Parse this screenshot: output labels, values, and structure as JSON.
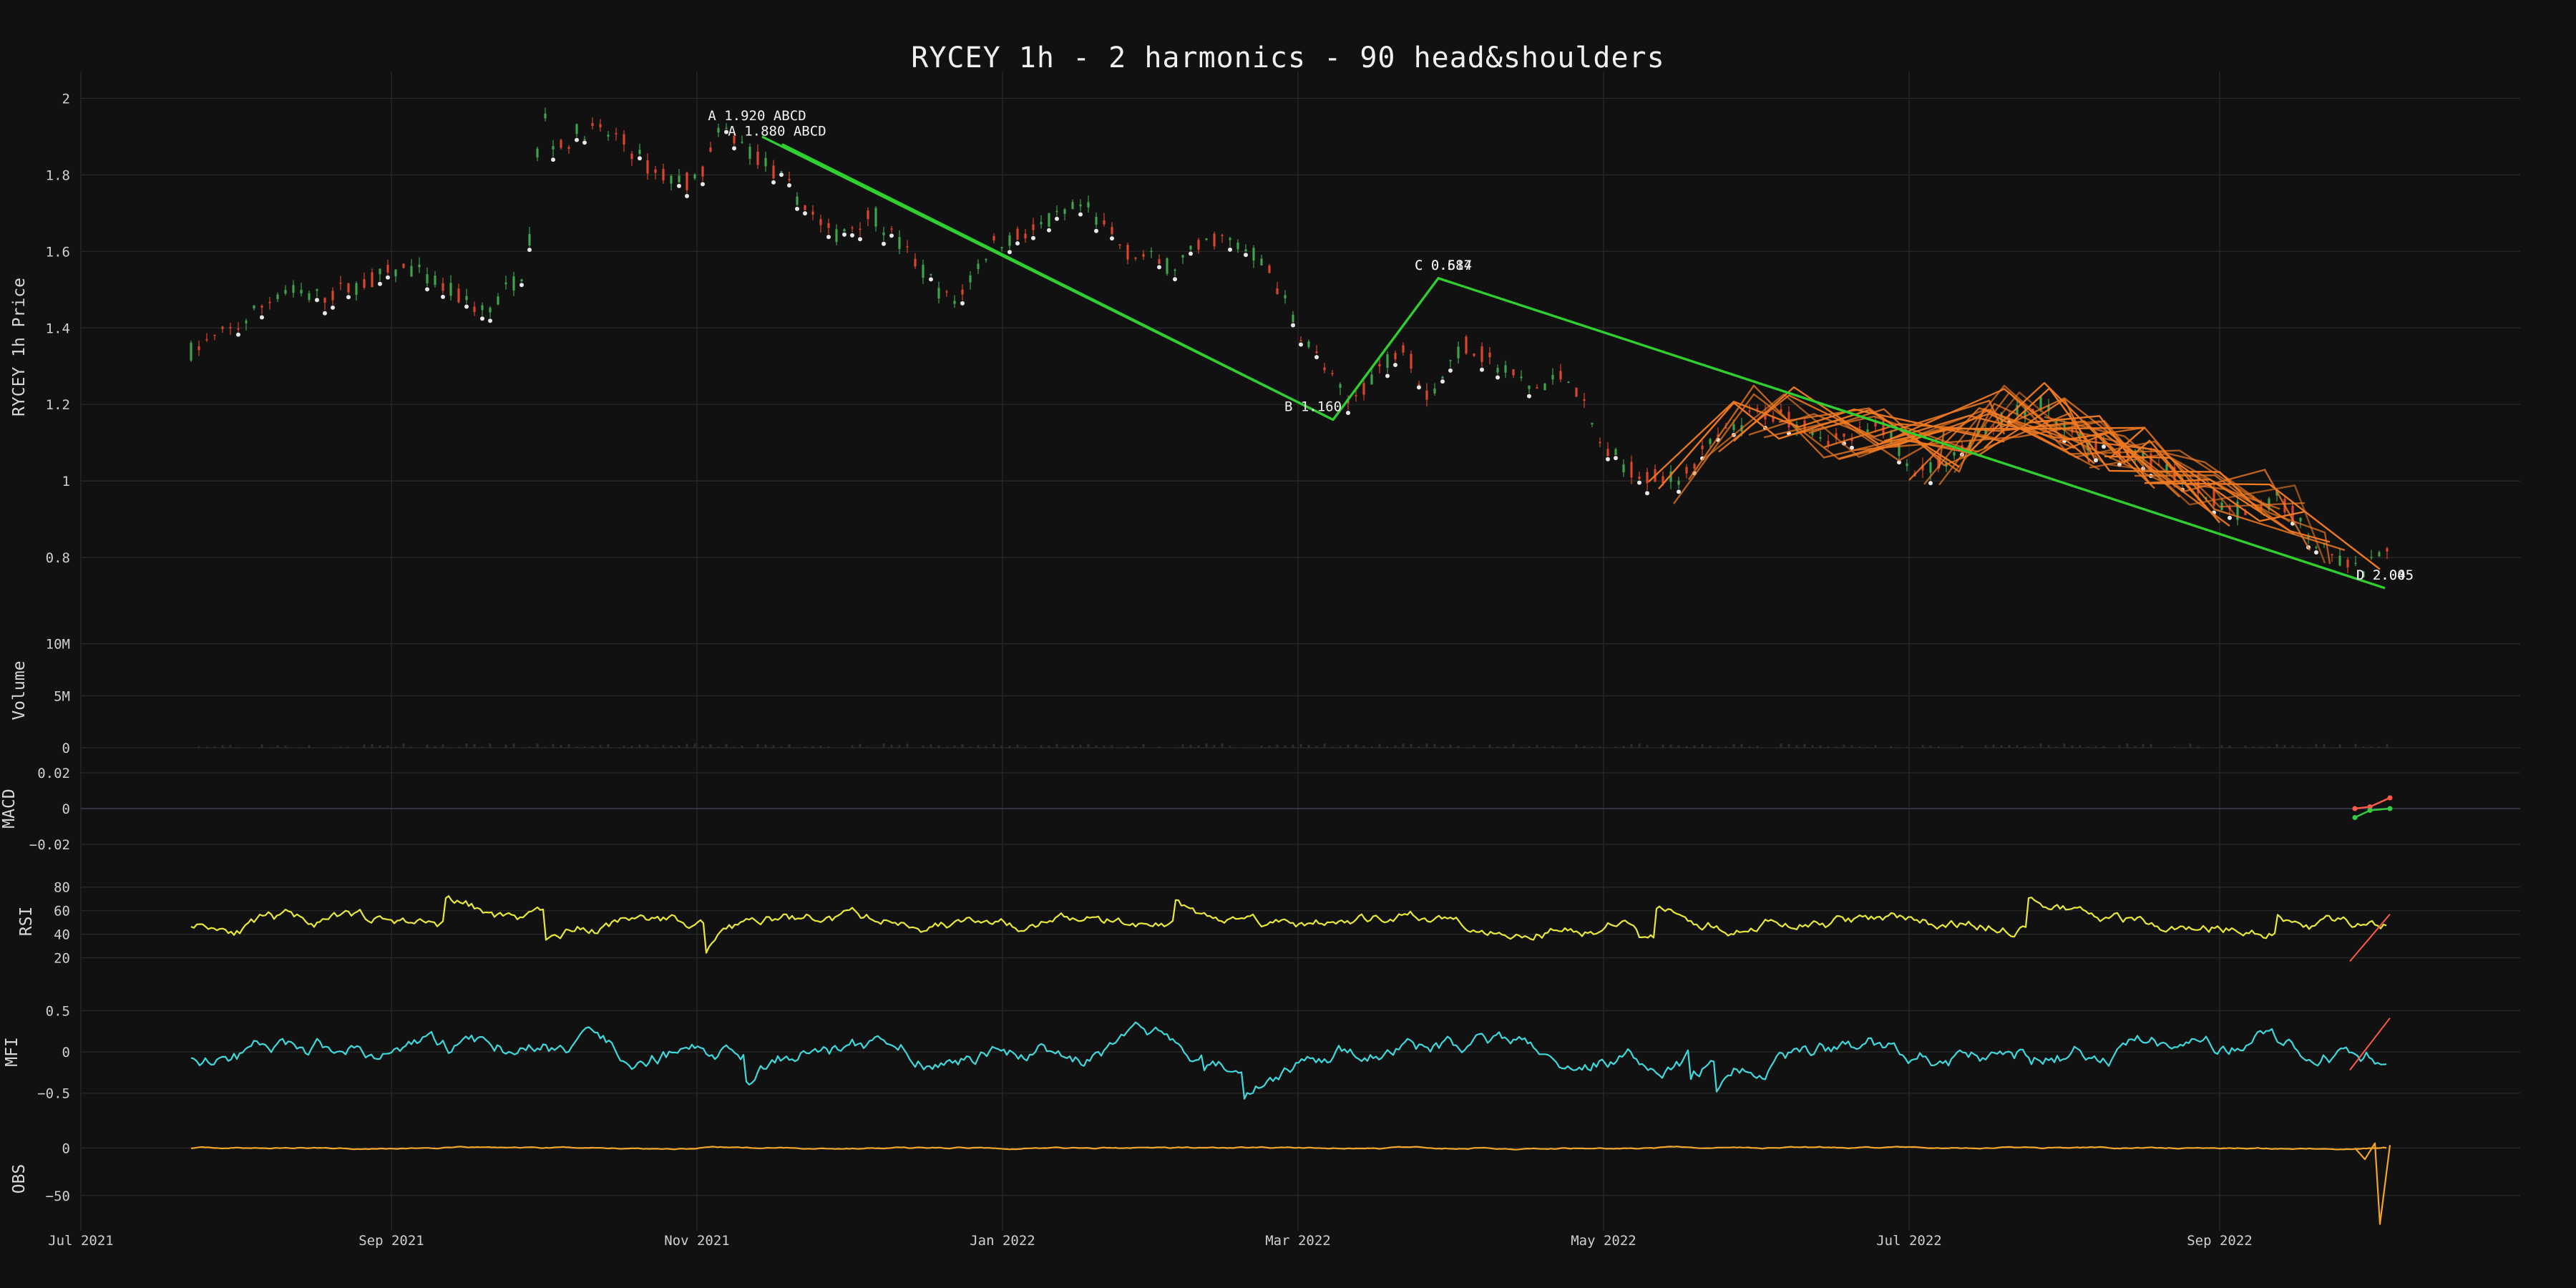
{
  "title": "RYCEY 1h  -  2 harmonics  -  90 head&shoulders",
  "colors": {
    "background": "#111111",
    "grid": "#2a2a2a",
    "candle_up": "#3fa34d",
    "candle_down": "#d9462b",
    "harmonic": "#2fcf2f",
    "head_shoulders": "#f07a22",
    "rsi": "#e8e83a",
    "mfi": "#3fd8dc",
    "obs": "#f2a52a",
    "macd_fast": "#ff5a4a",
    "macd_slow": "#33cc44"
  },
  "chart_data": {
    "type": "line",
    "x_axis": {
      "ticks": [
        "Jul 2021",
        "Sep 2021",
        "Nov 2021",
        "Jan 2022",
        "Mar 2022",
        "May 2022",
        "Jul 2022",
        "Sep 2022"
      ],
      "tick_dates": [
        "2021-07-01",
        "2021-09-01",
        "2021-11-01",
        "2022-01-01",
        "2022-03-01",
        "2022-05-01",
        "2022-07-01",
        "2022-09-01"
      ],
      "range": [
        "2021-07-01",
        "2022-10-31"
      ]
    },
    "panels": [
      {
        "id": "price",
        "ylabel": "RYCEY 1h Price",
        "yticks": [
          "0.8",
          "1",
          "1.2",
          "1.4",
          "1.6",
          "1.8",
          "2"
        ],
        "tick_values": [
          0.8,
          1.0,
          1.2,
          1.4,
          1.6,
          1.8,
          2.0
        ],
        "ylim": [
          0.63,
          2.07
        ],
        "series": {
          "x": [
            "2021-07-23",
            "2021-08-01",
            "2021-08-10",
            "2021-08-18",
            "2021-08-27",
            "2021-09-04",
            "2021-09-12",
            "2021-09-20",
            "2021-09-28",
            "2021-10-01",
            "2021-10-04",
            "2021-10-09",
            "2021-10-16",
            "2021-10-24",
            "2021-11-01",
            "2021-11-06",
            "2021-11-12",
            "2021-11-20",
            "2021-11-28",
            "2021-12-06",
            "2021-12-14",
            "2021-12-22",
            "2021-12-30",
            "2022-01-08",
            "2022-01-17",
            "2022-01-26",
            "2022-02-04",
            "2022-02-13",
            "2022-02-22",
            "2022-03-01",
            "2022-03-06",
            "2022-03-11",
            "2022-03-16",
            "2022-03-22",
            "2022-03-27",
            "2022-04-03",
            "2022-04-10",
            "2022-04-17",
            "2022-04-24",
            "2022-05-01",
            "2022-05-08",
            "2022-05-15",
            "2022-05-23",
            "2022-06-01",
            "2022-06-09",
            "2022-06-17",
            "2022-06-26",
            "2022-07-03",
            "2022-07-11",
            "2022-07-19",
            "2022-07-27",
            "2022-08-04",
            "2022-08-12",
            "2022-08-20",
            "2022-08-28",
            "2022-09-05",
            "2022-09-13",
            "2022-09-21",
            "2022-09-29",
            "2022-10-03"
          ],
          "close": [
            1.34,
            1.4,
            1.5,
            1.48,
            1.52,
            1.56,
            1.5,
            1.44,
            1.56,
            1.98,
            1.86,
            1.92,
            1.9,
            1.8,
            1.78,
            1.92,
            1.86,
            1.76,
            1.64,
            1.7,
            1.58,
            1.46,
            1.62,
            1.66,
            1.72,
            1.6,
            1.56,
            1.64,
            1.58,
            1.4,
            1.3,
            1.2,
            1.28,
            1.36,
            1.22,
            1.36,
            1.3,
            1.24,
            1.28,
            1.08,
            1.02,
            1.0,
            1.1,
            1.18,
            1.16,
            1.1,
            1.14,
            1.02,
            1.08,
            1.16,
            1.2,
            1.1,
            1.08,
            1.04,
            0.98,
            0.92,
            0.96,
            0.82,
            0.76,
            0.8
          ]
        },
        "annotations": [
          {
            "label": "A 1.920 ABCD",
            "x": "2021-11-13",
            "y": 1.92
          },
          {
            "label": "A 1.880 ABCD",
            "x": "2021-11-17",
            "y": 1.88
          },
          {
            "label": "B 1.160",
            "x": "2022-03-04",
            "y": 1.16
          },
          {
            "label": "C 0.584",
            "x": "2022-03-30",
            "y": 1.53
          },
          {
            "label": "C 0.617",
            "x": "2022-03-30",
            "y": 1.53
          },
          {
            "label": "D 2.005",
            "x": "2022-10-04",
            "y": 0.72
          },
          {
            "label": "D 2.045",
            "x": "2022-10-04",
            "y": 0.72
          }
        ],
        "harmonic_paths": [
          {
            "name": "ABCD",
            "points": [
              [
                "2021-11-14",
                1.9
              ],
              [
                "2022-03-08",
                1.16
              ],
              [
                "2022-03-29",
                1.53
              ],
              [
                "2022-10-04",
                0.72
              ]
            ]
          },
          {
            "name": "ABCD",
            "points": [
              [
                "2021-11-18",
                1.88
              ],
              [
                "2022-03-08",
                1.16
              ],
              [
                "2022-03-29",
                1.53
              ],
              [
                "2022-10-04",
                0.72
              ]
            ]
          }
        ]
      },
      {
        "id": "volume",
        "ylabel": "Volume",
        "yticks": [
          "10M",
          "5M",
          "0"
        ],
        "tick_values": [
          10000000,
          5000000,
          0
        ],
        "ylim": [
          0,
          11000000
        ]
      },
      {
        "id": "macd",
        "ylabel": "MACD",
        "yticks": [
          "0.02",
          "0",
          "−0.02"
        ],
        "tick_values": [
          0.02,
          0,
          -0.02
        ],
        "ylim": [
          -0.028,
          0.028
        ],
        "series": [
          {
            "x": [
              "2022-09-28",
              "2022-10-01",
              "2022-10-05"
            ],
            "values": [
              0.0,
              0.001,
              0.006
            ]
          },
          {
            "x": [
              "2022-09-28",
              "2022-10-01",
              "2022-10-05"
            ],
            "values": [
              -0.005,
              -0.001,
              0.0
            ]
          }
        ]
      },
      {
        "id": "rsi",
        "ylabel": "RSI",
        "yticks": [
          "80",
          "60",
          "40",
          "20"
        ],
        "tick_values": [
          80,
          60,
          40,
          20
        ],
        "ylim": [
          7,
          95
        ]
      },
      {
        "id": "mfi",
        "ylabel": "MFI",
        "yticks": [
          "0.5",
          "0",
          "−0.5"
        ],
        "tick_values": [
          0.5,
          0,
          -0.5
        ],
        "ylim": [
          -0.78,
          0.78
        ]
      },
      {
        "id": "obs",
        "ylabel": "OBS",
        "yticks": [
          "0",
          "−50"
        ],
        "tick_values": [
          0,
          -50
        ],
        "ylim": [
          -87,
          22
        ]
      }
    ]
  }
}
